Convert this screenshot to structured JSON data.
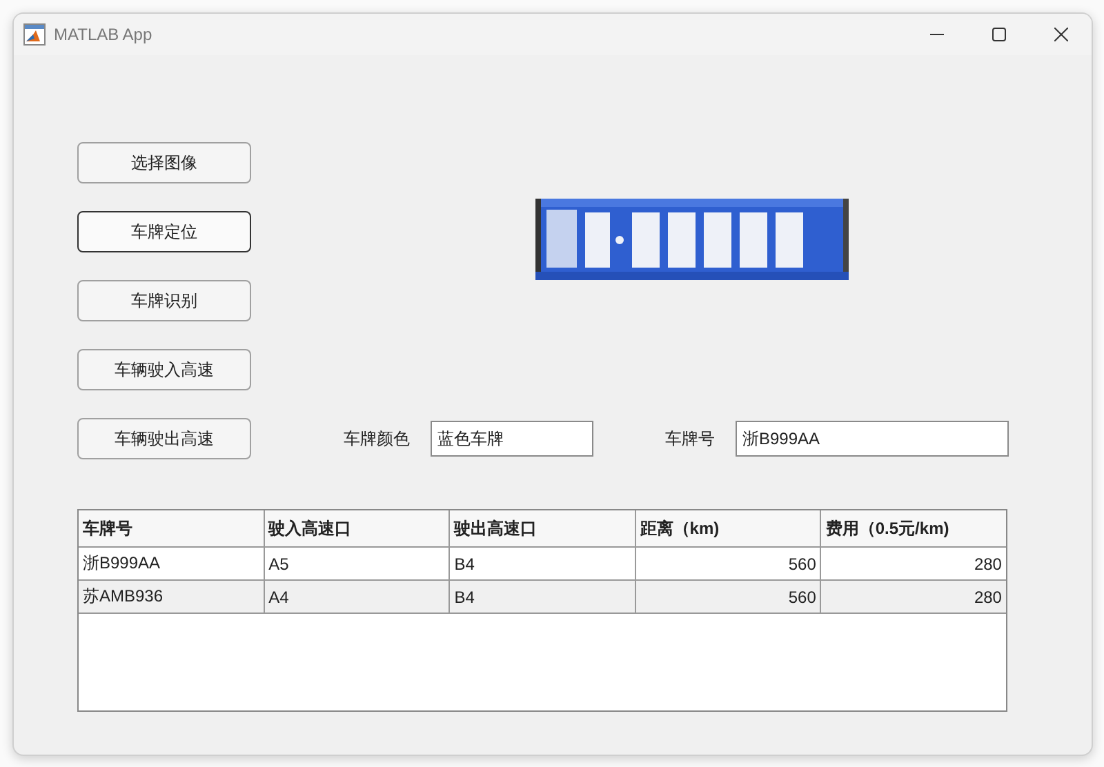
{
  "window": {
    "title": "MATLAB App"
  },
  "buttons": [
    {
      "label": "选择图像",
      "focused": false
    },
    {
      "label": "车牌定位",
      "focused": true
    },
    {
      "label": "车牌识别",
      "focused": false
    },
    {
      "label": "车辆驶入高速",
      "focused": false
    },
    {
      "label": "车辆驶出高速",
      "focused": false
    }
  ],
  "fields": [
    {
      "label": "车牌颜色",
      "value": "蓝色车牌"
    },
    {
      "label": "车牌号",
      "value": "浙B999AA"
    }
  ],
  "table": {
    "columns": [
      "车牌号",
      "驶入高速口",
      "驶出高速口",
      "距离（km)",
      "费用（0.5元/km)"
    ],
    "rows": [
      [
        "浙B999AA",
        "A5",
        "B4",
        "560",
        "280"
      ],
      [
        "苏AMB936",
        "A4",
        "B4",
        "560",
        "280"
      ]
    ]
  }
}
